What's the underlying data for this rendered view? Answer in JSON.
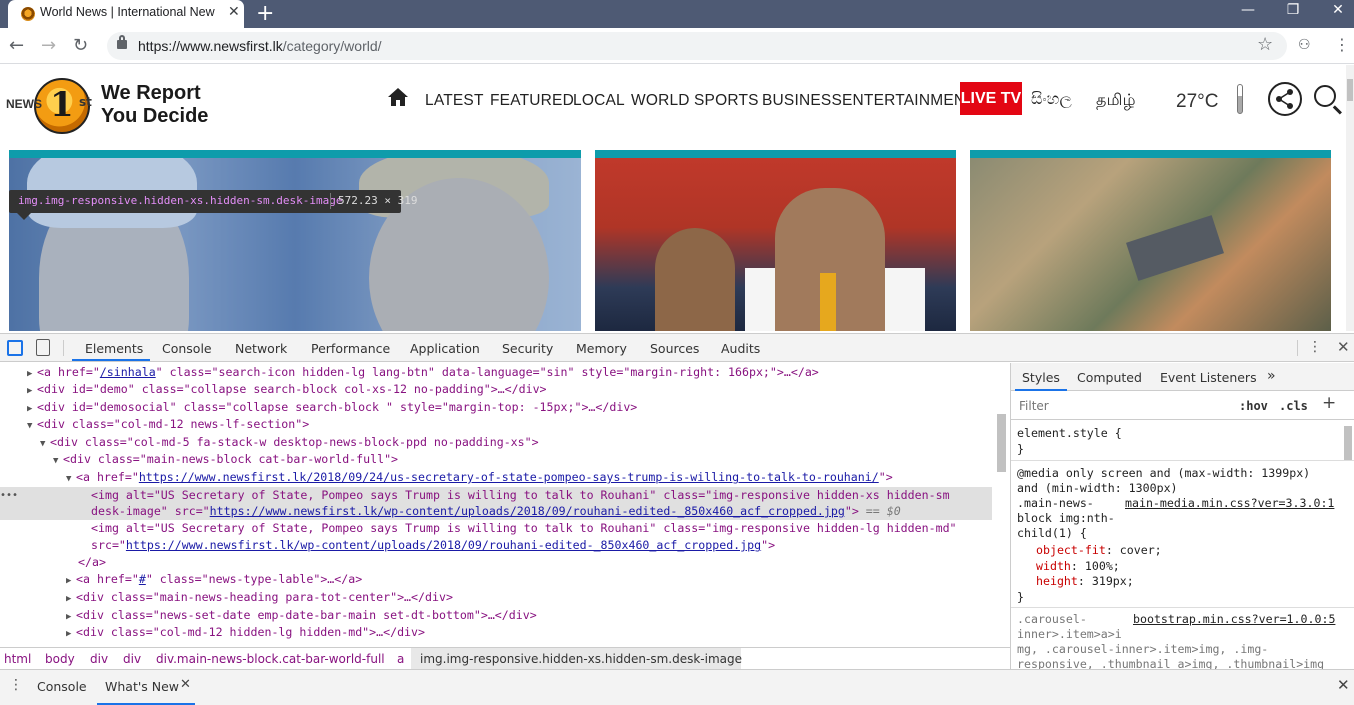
{
  "browser": {
    "tab_title": "World News | International News",
    "tab_close": "✕",
    "new_tab": "+",
    "win_minimize": "—",
    "win_restore": "❐",
    "win_close": "✕",
    "url_host": "https://www.newsfirst.lk",
    "url_path": "/category/world/",
    "back": "←",
    "forward": "→",
    "reload": "↻",
    "star": "☆",
    "menu": "⋮",
    "ext": "⚇"
  },
  "site": {
    "logo_news": "NEWS",
    "logo_one": "1",
    "logo_st": "st",
    "tagline_1": "We Report",
    "tagline_2": "You Decide",
    "nav": [
      "LATEST",
      "FEATURED",
      "LOCAL",
      "WORLD",
      "SPORTS",
      "BUSINESS",
      "ENTERTAINMENT"
    ],
    "live_tv": "LIVE TV",
    "lang_sinhala": "සිංහල",
    "lang_tamil": "தமிழ்",
    "temperature": "27°C",
    "accent_color": "#0e9cab",
    "live_color": "#e30613"
  },
  "tooltip": {
    "selector": "img.img-responsive.hidden-xs.hidden-sm.desk-image",
    "size": "572.23 × 319"
  },
  "devtools": {
    "tabs": [
      "Elements",
      "Console",
      "Network",
      "Performance",
      "Application",
      "Security",
      "Memory",
      "Sources",
      "Audits"
    ],
    "more": "⋮",
    "close": "✕",
    "dom": {
      "l1": {
        "a": "<a href=\"",
        "b": "/sinhala",
        "c": "\" class=\"search-icon hidden-lg lang-btn\" data-language=\"sin\" style=\"margin-right: 166px;\">…</a>"
      },
      "l2": "<div id=\"demo\" class=\"collapse search-block col-xs-12 no-padding\">…</div>",
      "l3": "<div id=\"demosocial\" class=\"collapse search-block \" style=\"margin-top: -15px;\">…</div>",
      "l4": "<div class=\"col-md-12 news-lf-section\">",
      "l5": "<div class=\"col-md-5 fa-stack-w desktop-news-block-ppd no-padding-xs\">",
      "l6": "<div class=\"main-news-block cat-bar-world-full\">",
      "l7": {
        "a": "<a href=\"",
        "b": "https://www.newsfirst.lk/2018/09/24/us-secretary-of-state-pompeo-says-trump-is-willing-to-talk-to-rouhani/",
        "c": "\">"
      },
      "l8": "<img alt=\"US Secretary of State, Pompeo says Trump is willing to talk to Rouhani\" class=\"img-responsive hidden-xs hidden-sm",
      "l9": {
        "a": "desk-image\" src=\"",
        "b": "https://www.newsfirst.lk/wp-content/uploads/2018/09/rouhani-edited-_850x460_acf_cropped.jpg",
        "c": "\">",
        "d": " == $0"
      },
      "l10": "<img alt=\"US Secretary of State, Pompeo says Trump is willing to talk to Rouhani\" class=\"img-responsive hidden-lg hidden-md\"",
      "l11": {
        "a": "src=\"",
        "b": "https://www.newsfirst.lk/wp-content/uploads/2018/09/rouhani-edited-_850x460_acf_cropped.jpg",
        "c": "\">"
      },
      "l12": "</a>",
      "l13": {
        "a": "<a href=\"",
        "b": "#",
        "c": "\" class=\"news-type-lable\">…</a>"
      },
      "l14": "<div class=\"main-news-heading para-tot-center\">…</div>",
      "l15": "<div class=\"news-set-date emp-date-bar-main set-dt-bottom\">…</div>",
      "l16": "<div class=\"col-md-12 hidden-lg hidden-md\">…</div>"
    },
    "breadcrumbs": [
      "html",
      "body",
      "div",
      "div",
      "div.main-news-block.cat-bar-world-full",
      "a",
      "img.img-responsive.hidden-xs.hidden-sm.desk-image"
    ],
    "styles": {
      "tabs": [
        "Styles",
        "Computed",
        "Event Listeners",
        "»"
      ],
      "filter_placeholder": "Filter",
      "hov": ":hov",
      "cls": ".cls",
      "element_style": "element.style {",
      "close_brace": "}",
      "media_1": "@media only screen and (max-width: 1399px)",
      "media_2": "and (min-width: 1300px)",
      "rule1_sel_a": ".main-news-",
      "rule1_src": "main-media.min.css?ver=3.3.0:1",
      "rule1_sel_b": "block img:nth-",
      "rule1_sel_c": "child(1) {",
      "props": [
        {
          "name": "object-fit",
          "value": "cover;"
        },
        {
          "name": "width",
          "value": "100%;"
        },
        {
          "name": "height",
          "value": "319px;"
        }
      ],
      "rule2_sel_a": ".carousel-",
      "rule2_src": "bootstrap.min.css?ver=1.0.0:5",
      "rule2_sel_b": "inner>.item>a>i",
      "rule2_sel_c": "mg, .carousel-inner>.item>img, .img-",
      "rule2_sel_d": "responsive, .thumbnail a>img, .thumbnail>img"
    },
    "drawer": {
      "tabs": [
        "Console",
        "What's New"
      ],
      "tab_close": "✕",
      "close": "✕"
    }
  }
}
